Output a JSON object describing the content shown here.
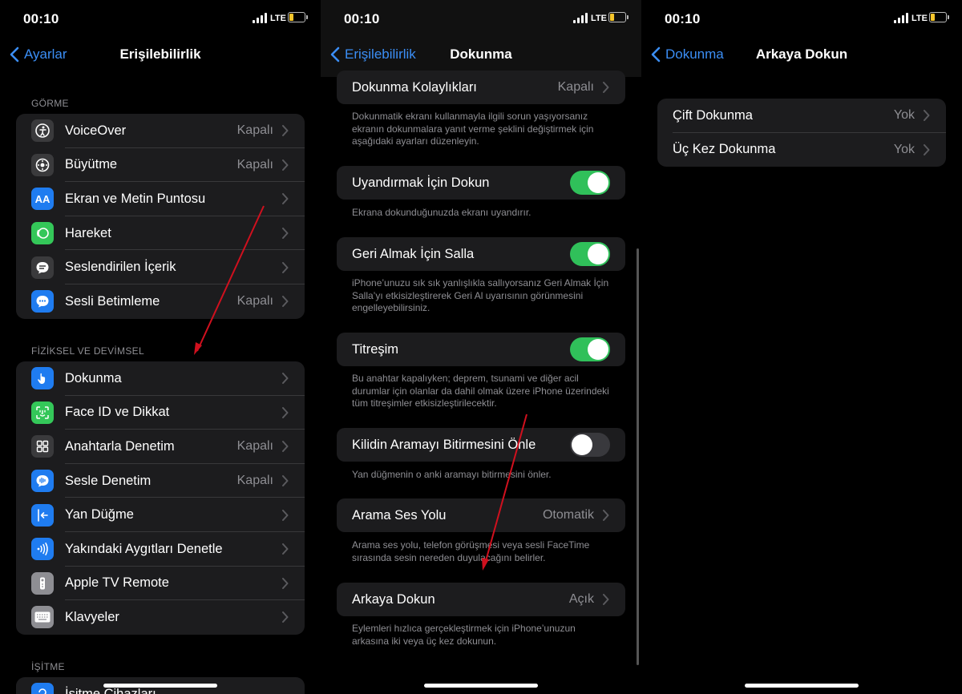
{
  "status": {
    "time": "00:10",
    "network": "LTE"
  },
  "accessibility": {
    "back_label": "Ayarlar",
    "title": "Erişilebilirlik",
    "section_vision": "GÖRME",
    "vision_items": [
      {
        "label": "VoiceOver",
        "value": "Kapalı",
        "icon": "voiceover-icon"
      },
      {
        "label": "Büyütme",
        "value": "Kapalı",
        "icon": "zoom-icon"
      },
      {
        "label": "Ekran ve Metin Puntosu",
        "value": "",
        "icon": "text-size-icon"
      },
      {
        "label": "Hareket",
        "value": "",
        "icon": "motion-icon"
      },
      {
        "label": "Seslendirilen İçerik",
        "value": "",
        "icon": "spoken-content-icon"
      },
      {
        "label": "Sesli Betimleme",
        "value": "Kapalı",
        "icon": "audio-description-icon"
      }
    ],
    "section_physical": "FİZİKSEL VE DEVİMSEL",
    "physical_items": [
      {
        "label": "Dokunma",
        "value": "",
        "icon": "touch-icon"
      },
      {
        "label": "Face ID ve Dikkat",
        "value": "",
        "icon": "face-id-icon"
      },
      {
        "label": "Anahtarla Denetim",
        "value": "Kapalı",
        "icon": "switch-control-icon"
      },
      {
        "label": "Sesle Denetim",
        "value": "Kapalı",
        "icon": "voice-control-icon"
      },
      {
        "label": "Yan Düğme",
        "value": "",
        "icon": "side-button-icon"
      },
      {
        "label": "Yakındaki Aygıtları Denetle",
        "value": "",
        "icon": "nearby-devices-icon"
      },
      {
        "label": "Apple TV Remote",
        "value": "",
        "icon": "tv-remote-icon"
      },
      {
        "label": "Klavyeler",
        "value": "",
        "icon": "keyboard-icon"
      }
    ],
    "section_hearing": "İŞİTME",
    "hearing_first_item": "İşitme Cihazları"
  },
  "touch": {
    "back_label": "Erişilebilirlik",
    "title": "Dokunma",
    "assistive_label": "Dokunma Kolaylıkları",
    "assistive_value": "Kapalı",
    "assistive_footer": "Dokunmatik ekranı kullanmayla ilgili sorun yaşıyorsanız ekranın dokunmalara yanıt verme şeklini değiştirmek için aşağıdaki ayarları düzenleyin.",
    "tap_to_wake_label": "Uyandırmak İçin Dokun",
    "tap_to_wake_footer": "Ekrana dokunduğunuzda ekranı uyandırır.",
    "shake_undo_label": "Geri Almak İçin Salla",
    "shake_undo_footer": "iPhone’unuzu sık sık yanlışlıkla sallıyorsanız Geri Almak İçin Salla’yı etkisizleştirerek Geri Al uyarısının görünmesini engelleyebilirsiniz.",
    "vibration_label": "Titreşim",
    "vibration_footer": "Bu anahtar kapalıyken; deprem, tsunami ve diğer acil durumlar için olanlar da dahil olmak üzere iPhone üzerindeki tüm titreşimler etkisizleştirilecektir.",
    "lock_call_label": "Kilidin Aramayı Bitirmesini Önle",
    "lock_call_footer": "Yan düğmenin o anki aramayı bitirmesini önler.",
    "call_audio_label": "Arama Ses Yolu",
    "call_audio_value": "Otomatik",
    "call_audio_footer": "Arama ses yolu, telefon görüşmesi veya sesli FaceTime sırasında sesin nereden duyulacağını belirler.",
    "back_tap_label": "Arkaya Dokun",
    "back_tap_value": "Açık",
    "back_tap_footer": "Eylemleri hızlıca gerçekleştirmek için iPhone’unuzun arkasına iki veya üç kez dokunun.",
    "toggles": {
      "tap_to_wake": true,
      "shake_undo": true,
      "vibration": true,
      "lock_call": false
    }
  },
  "back_tap": {
    "back_label": "Dokunma",
    "title": "Arkaya Dokun",
    "items": [
      {
        "label": "Çift Dokunma",
        "value": "Yok"
      },
      {
        "label": "Üç Kez Dokunma",
        "value": "Yok"
      }
    ]
  },
  "colors": {
    "accent": "#3b8ef5",
    "toggle_on": "#30c05a",
    "annotation_arrow": "#d0101e"
  }
}
